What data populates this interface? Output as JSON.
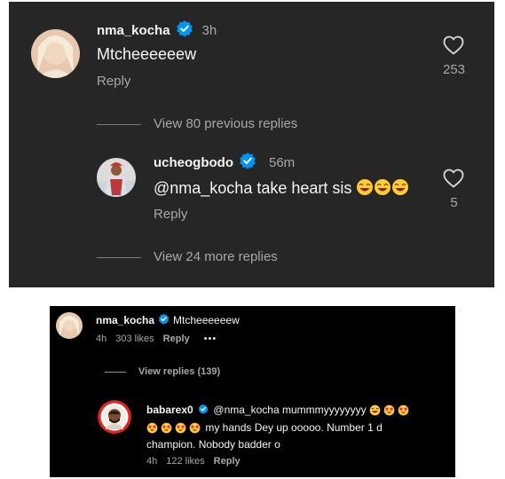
{
  "top": {
    "comment": {
      "username": "nma_kocha",
      "time": "3h",
      "text": "Mtcheeeeeew",
      "reply_label": "Reply",
      "like_count": "253"
    },
    "view_previous": "View 80 previous replies",
    "reply": {
      "username": "ucheogbodo",
      "time": "56m",
      "text": "@nma_kocha take heart sis",
      "reply_label": "Reply",
      "like_count": "5"
    },
    "view_more": "View 24 more replies"
  },
  "bottom": {
    "comment": {
      "username": "nma_kocha",
      "text": "Mtcheeeeeew",
      "time": "4h",
      "likes": "303 likes",
      "reply_label": "Reply",
      "more": "•••"
    },
    "view_replies": "View replies (139)",
    "reply": {
      "username": "babarex0",
      "line1": "@nma_kocha mummmyyyyyyyy",
      "line2": "my hands Dey up ooooo. Number 1 d",
      "line3": "champion. Nobody badder o",
      "time": "4h",
      "likes": "122 likes",
      "reply_label": "Reply"
    }
  },
  "colors": {
    "top_background": "#262626",
    "bottom_background": "#000000",
    "verified_blue": "#0095f6",
    "muted_text": "#a8a8a8"
  }
}
